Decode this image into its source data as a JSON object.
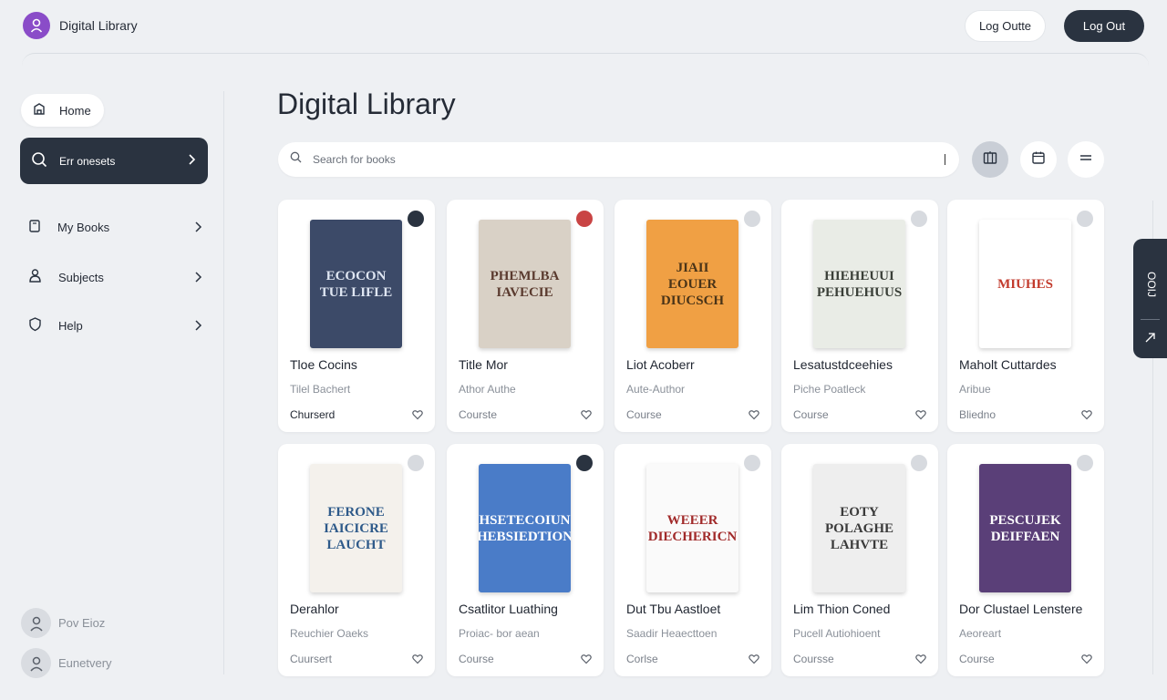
{
  "header": {
    "app_title": "Digital Library",
    "logout_light_label": "Log Outte",
    "logout_dark_label": "Log Out"
  },
  "sidebar": {
    "home_label": "Home",
    "active_label": "Err onesets",
    "items": [
      {
        "label": "My Books",
        "icon": "book-icon"
      },
      {
        "label": "Subjects",
        "icon": "subjects-icon"
      },
      {
        "label": "Help",
        "icon": "help-icon"
      }
    ],
    "users": [
      {
        "name": "Pov Eioz"
      },
      {
        "name": "Eunetvery"
      }
    ]
  },
  "main": {
    "title": "Digital Library",
    "search_placeholder": "Search for books",
    "view_buttons": [
      "library-grid-icon",
      "calendar-icon",
      "list-icon"
    ]
  },
  "books": [
    {
      "title": "Tloe Cocins",
      "author": "Tilel Bachert",
      "course": "Churserd",
      "course_strong": true,
      "dot": "#2a3340",
      "cover_bg": "#3c4a68",
      "cover_fg": "#dfe6f2",
      "cover_text": "ECOCON TUE LIFLE"
    },
    {
      "title": "Title Mor",
      "author": "Athor Authe",
      "course": "Courste",
      "course_strong": false,
      "dot": "#c94444",
      "cover_bg": "#d9d1c6",
      "cover_fg": "#5a3a2e",
      "cover_text": "PHEMLBA IAVECIE"
    },
    {
      "title": "Liot Acoberr",
      "author": "Aute-Author",
      "course": "Course",
      "course_strong": false,
      "dot": "#d7dadf",
      "cover_bg": "#f0a044",
      "cover_fg": "#4a3418",
      "cover_text": "JIAII EOUER DIUCSCH"
    },
    {
      "title": "Lesatustdceehies",
      "author": "Piche Poatleck",
      "course": "Course",
      "course_strong": false,
      "dot": "#d7dadf",
      "cover_bg": "#e9ece6",
      "cover_fg": "#3a3f38",
      "cover_text": "HIEHEUUI PEHUEHUUS"
    },
    {
      "title": "Maholt Cuttardes",
      "author": "Aribue",
      "course": "Bliedno",
      "course_strong": false,
      "dot": "#d7dadf",
      "cover_bg": "#ffffff",
      "cover_fg": "#c23a2c",
      "cover_text": "MIUHES"
    },
    {
      "title": "Derahlor",
      "author": "Reuchier Oaeks",
      "course": "Cuursert",
      "course_strong": false,
      "dot": "#d7dadf",
      "cover_bg": "#f4f1ec",
      "cover_fg": "#2e5a8a",
      "cover_text": "FERONE IAICICRE LAUCHT"
    },
    {
      "title": "Csatlitor Luathing",
      "author": "Proiac- bor aean",
      "course": "Course",
      "course_strong": false,
      "dot": "#2a3340",
      "cover_bg": "#4a7cc8",
      "cover_fg": "#ffffff",
      "cover_text": "HSETECOIUN HEBSIEDTION"
    },
    {
      "title": "Dut Tbu Aastloet",
      "author": "Saadir Heaecttoen",
      "course": "Corlse",
      "course_strong": false,
      "dot": "#d7dadf",
      "cover_bg": "#fafafa",
      "cover_fg": "#a12a2a",
      "cover_text": "WEEER DIECHERICN"
    },
    {
      "title": "Lim Thion Coned",
      "author": "Pucell Autiohioent",
      "course": "Coursse",
      "course_strong": false,
      "dot": "#d7dadf",
      "cover_bg": "#eeeeee",
      "cover_fg": "#3a3a3a",
      "cover_text": "EOTY POLAGHE LAHVTE"
    },
    {
      "title": "Dor Clustael Lenstere",
      "author": "Aeoreart",
      "course": "Course",
      "course_strong": false,
      "dot": "#d7dadf",
      "cover_bg": "#5a3f78",
      "cover_fg": "#ffffff",
      "cover_text": "PESCUJEK DEIFFAEN"
    }
  ],
  "side_tab": {
    "label": "OOIJ"
  },
  "colors": {
    "accent": "#8a4cc8",
    "dark": "#2a3340",
    "background": "#eef0f3"
  }
}
